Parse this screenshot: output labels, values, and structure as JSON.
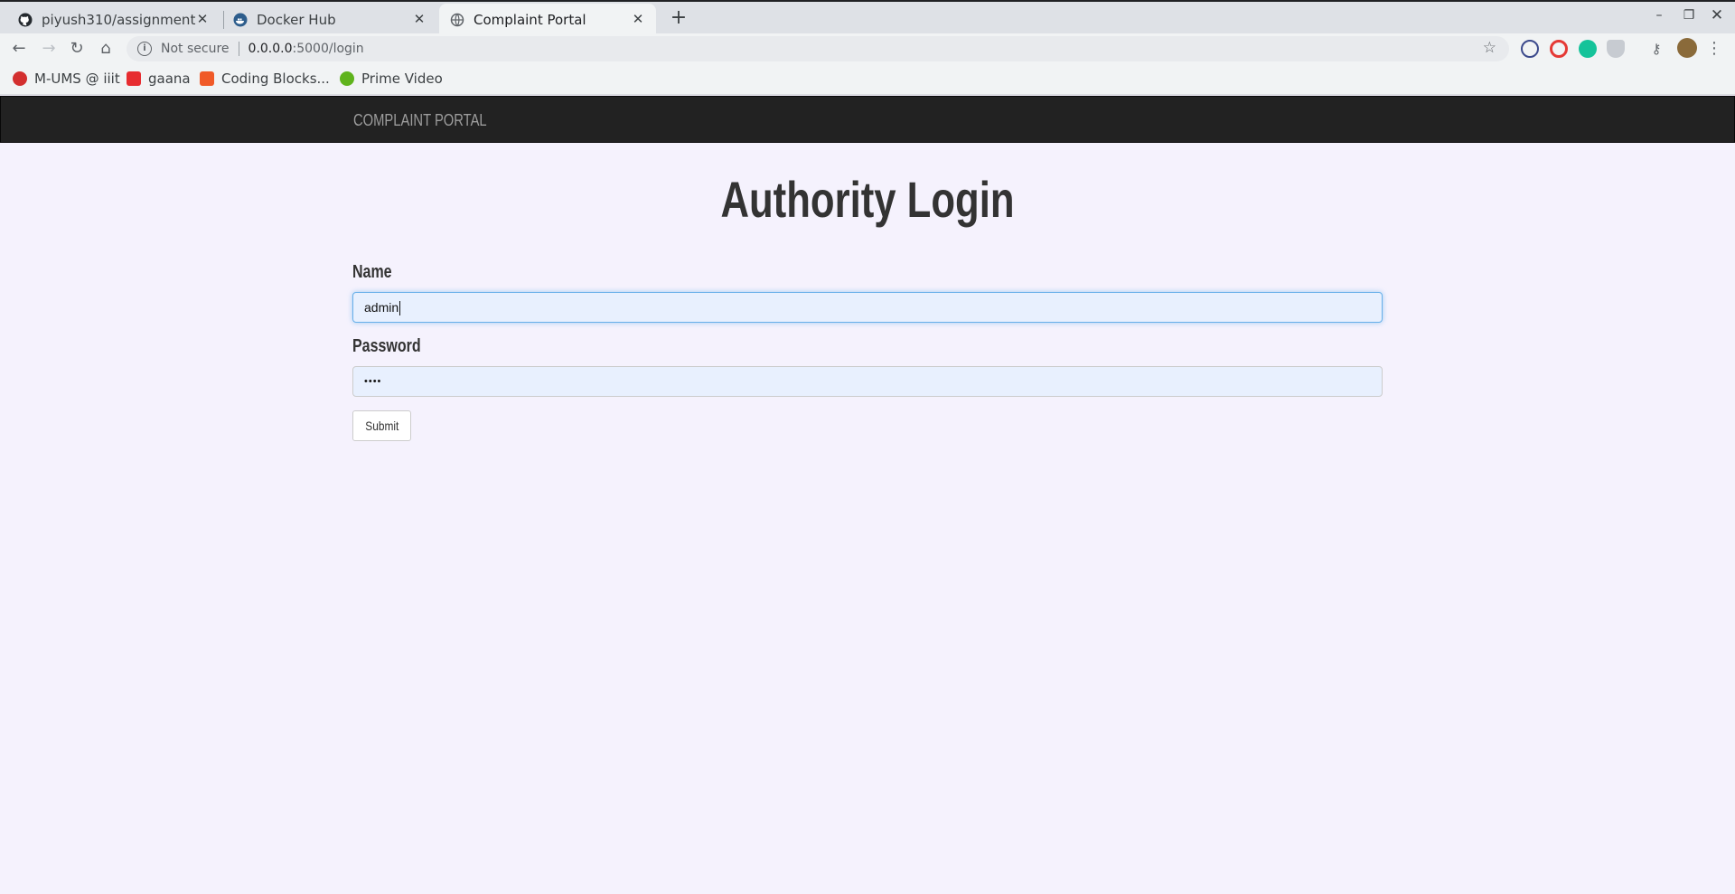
{
  "browser": {
    "tabs": [
      {
        "title": "piyush310/assignment",
        "icon": "github-icon",
        "active": false
      },
      {
        "title": "Docker Hub",
        "icon": "docker-icon",
        "active": false
      },
      {
        "title": "Complaint Portal",
        "icon": "globe-icon",
        "active": true
      }
    ],
    "new_tab_symbol": "+",
    "address": {
      "security_label": "Not secure",
      "host": "0.0.0.0",
      "path": ":5000/login"
    },
    "bookmarks": [
      {
        "label": "M-UMS @ iiit",
        "icon": "m-ums-icon",
        "color": "#d32f2f"
      },
      {
        "label": "gaana",
        "icon": "gaana-icon",
        "color": "#e72c30"
      },
      {
        "label": "Coding Blocks...",
        "icon": "coding-blocks-icon",
        "color": "#f05a28"
      },
      {
        "label": "Prime Video",
        "icon": "prime-video-icon",
        "color": "#5fb31c"
      }
    ]
  },
  "page": {
    "brand": "COMPLAINT PORTAL",
    "title": "Authority Login",
    "form": {
      "name_label": "Name",
      "name_value": "admin",
      "password_label": "Password",
      "password_masked": "••••",
      "submit_label": "Submit"
    }
  },
  "colors": {
    "navbar_bg": "#222222",
    "page_bg": "#f5f2fd",
    "input_autofill_bg": "#e8f0fe",
    "focus_border": "#66afe9"
  }
}
